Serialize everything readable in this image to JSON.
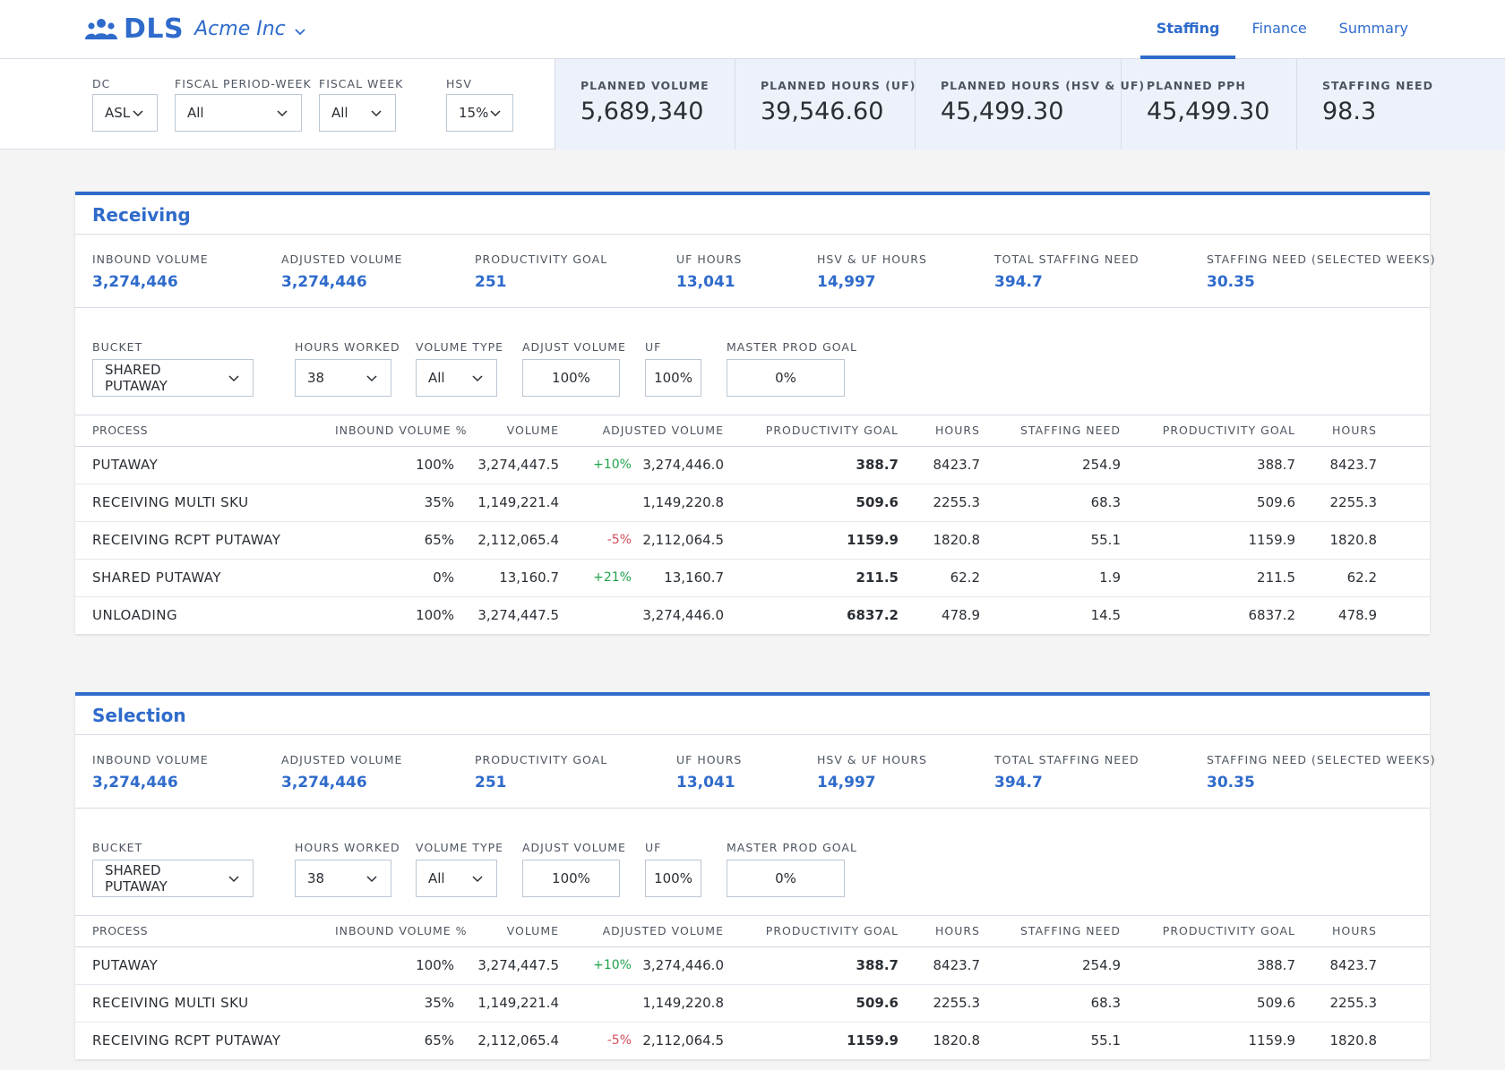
{
  "header": {
    "brand": "DLS",
    "org": "Acme Inc",
    "nav": [
      {
        "label": "Staffing",
        "active": true
      },
      {
        "label": "Finance",
        "active": false
      },
      {
        "label": "Summary",
        "active": false
      }
    ]
  },
  "filters": {
    "dc": {
      "label": "DC",
      "value": "ASL"
    },
    "fiscal_period_week": {
      "label": "FISCAL PERIOD-WEEK",
      "value": "All"
    },
    "fiscal_week": {
      "label": "FISCAL WEEK",
      "value": "All"
    },
    "hsv": {
      "label": "HSV",
      "value": "15%"
    }
  },
  "kpis": [
    {
      "label": "PLANNED VOLUME",
      "value": "5,689,340"
    },
    {
      "label": "PLANNED HOURS (UF)",
      "value": "39,546.60"
    },
    {
      "label": "PLANNED HOURS (HSV & UF)",
      "value": "45,499.30"
    },
    {
      "label": "PLANNED PPH",
      "value": "45,499.30"
    },
    {
      "label": "STAFFING NEED",
      "value": "98.3"
    }
  ],
  "sections": [
    {
      "title": "Receiving",
      "stats": [
        {
          "label": "INBOUND VOLUME",
          "value": "3,274,446"
        },
        {
          "label": "ADJUSTED VOLUME",
          "value": "3,274,446"
        },
        {
          "label": "PRODUCTIVITY GOAL",
          "value": "251"
        },
        {
          "label": "UF HOURS",
          "value": "13,041"
        },
        {
          "label": "HSV & UF HOURS",
          "value": "14,997"
        },
        {
          "label": "TOTAL STAFFING NEED",
          "value": "394.7"
        },
        {
          "label": "STAFFING NEED (SELECTED WEEKS)",
          "value": "30.35"
        }
      ],
      "controls": {
        "bucket": {
          "label": "BUCKET",
          "value": "SHARED PUTAWAY"
        },
        "hours_worked": {
          "label": "HOURS WORKED",
          "value": "38"
        },
        "volume_type": {
          "label": "VOLUME TYPE",
          "value": "All"
        },
        "adjust_volume": {
          "label": "ADJUST VOLUME",
          "value": "100%"
        },
        "uf": {
          "label": "UF",
          "value": "100%"
        },
        "master_prod_goal": {
          "label": "MASTER PROD GOAL",
          "value": "0%"
        }
      },
      "columns": [
        "PROCESS",
        "INBOUND VOLUME %",
        "VOLUME",
        "ADJUSTED VOLUME",
        "PRODUCTIVITY GOAL",
        "HOURS",
        "STAFFING NEED",
        "PRODUCTIVITY GOAL",
        "HOURS"
      ],
      "rows": [
        {
          "process": "PUTAWAY",
          "inbound_pct": "100%",
          "volume": "3,274,447.5",
          "change": "+10%",
          "adjusted": "3,274,446.0",
          "prod_goal": "388.7",
          "hours": "8423.7",
          "staffing": "254.9",
          "prod_goal2": "388.7",
          "hours2": "8423.7"
        },
        {
          "process": "RECEIVING MULTI SKU",
          "inbound_pct": "35%",
          "volume": "1,149,221.4",
          "change": "",
          "adjusted": "1,149,220.8",
          "prod_goal": "509.6",
          "hours": "2255.3",
          "staffing": "68.3",
          "prod_goal2": "509.6",
          "hours2": "2255.3"
        },
        {
          "process": "RECEIVING RCPT PUTAWAY",
          "inbound_pct": "65%",
          "volume": "2,112,065.4",
          "change": "-5%",
          "adjusted": "2,112,064.5",
          "prod_goal": "1159.9",
          "hours": "1820.8",
          "staffing": "55.1",
          "prod_goal2": "1159.9",
          "hours2": "1820.8"
        },
        {
          "process": "SHARED PUTAWAY",
          "inbound_pct": "0%",
          "volume": "13,160.7",
          "change": "+21%",
          "adjusted": "13,160.7",
          "prod_goal": "211.5",
          "hours": "62.2",
          "staffing": "1.9",
          "prod_goal2": "211.5",
          "hours2": "62.2"
        },
        {
          "process": "UNLOADING",
          "inbound_pct": "100%",
          "volume": "3,274,447.5",
          "change": "",
          "adjusted": "3,274,446.0",
          "prod_goal": "6837.2",
          "hours": "478.9",
          "staffing": "14.5",
          "prod_goal2": "6837.2",
          "hours2": "478.9"
        }
      ]
    },
    {
      "title": "Selection",
      "stats": [
        {
          "label": "INBOUND VOLUME",
          "value": "3,274,446"
        },
        {
          "label": "ADJUSTED VOLUME",
          "value": "3,274,446"
        },
        {
          "label": "PRODUCTIVITY GOAL",
          "value": "251"
        },
        {
          "label": "UF HOURS",
          "value": "13,041"
        },
        {
          "label": "HSV & UF HOURS",
          "value": "14,997"
        },
        {
          "label": "TOTAL STAFFING NEED",
          "value": "394.7"
        },
        {
          "label": "STAFFING NEED (SELECTED WEEKS)",
          "value": "30.35"
        }
      ],
      "controls": {
        "bucket": {
          "label": "BUCKET",
          "value": "SHARED PUTAWAY"
        },
        "hours_worked": {
          "label": "HOURS WORKED",
          "value": "38"
        },
        "volume_type": {
          "label": "VOLUME TYPE",
          "value": "All"
        },
        "adjust_volume": {
          "label": "ADJUST VOLUME",
          "value": "100%"
        },
        "uf": {
          "label": "UF",
          "value": "100%"
        },
        "master_prod_goal": {
          "label": "MASTER PROD GOAL",
          "value": "0%"
        }
      },
      "columns": [
        "PROCESS",
        "INBOUND VOLUME %",
        "VOLUME",
        "ADJUSTED VOLUME",
        "PRODUCTIVITY GOAL",
        "HOURS",
        "STAFFING NEED",
        "PRODUCTIVITY GOAL",
        "HOURS"
      ],
      "rows": [
        {
          "process": "PUTAWAY",
          "inbound_pct": "100%",
          "volume": "3,274,447.5",
          "change": "+10%",
          "adjusted": "3,274,446.0",
          "prod_goal": "388.7",
          "hours": "8423.7",
          "staffing": "254.9",
          "prod_goal2": "388.7",
          "hours2": "8423.7"
        },
        {
          "process": "RECEIVING MULTI SKU",
          "inbound_pct": "35%",
          "volume": "1,149,221.4",
          "change": "",
          "adjusted": "1,149,220.8",
          "prod_goal": "509.6",
          "hours": "2255.3",
          "staffing": "68.3",
          "prod_goal2": "509.6",
          "hours2": "2255.3"
        },
        {
          "process": "RECEIVING RCPT PUTAWAY",
          "inbound_pct": "65%",
          "volume": "2,112,065.4",
          "change": "-5%",
          "adjusted": "2,112,064.5",
          "prod_goal": "1159.9",
          "hours": "1820.8",
          "staffing": "55.1",
          "prod_goal2": "1159.9",
          "hours2": "1820.8"
        }
      ]
    }
  ]
}
